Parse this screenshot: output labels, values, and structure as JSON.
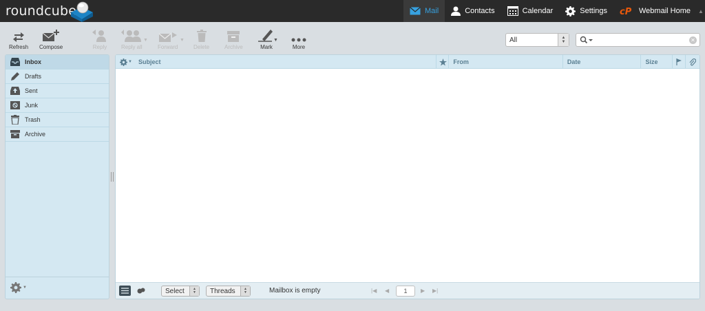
{
  "app": {
    "logo_text": "roundcube"
  },
  "topnav": {
    "mail": "Mail",
    "contacts": "Contacts",
    "calendar": "Calendar",
    "settings": "Settings",
    "webmail_home": "Webmail Home"
  },
  "toolbar": {
    "refresh": "Refresh",
    "compose": "Compose",
    "reply": "Reply",
    "reply_all": "Reply all",
    "forward": "Forward",
    "delete": "Delete",
    "archive": "Archive",
    "mark": "Mark",
    "more": "More"
  },
  "filter": {
    "value": "All"
  },
  "search": {
    "value": ""
  },
  "folders": [
    {
      "label": "Inbox",
      "icon": "inbox-icon"
    },
    {
      "label": "Drafts",
      "icon": "pencil-icon"
    },
    {
      "label": "Sent",
      "icon": "sent-icon"
    },
    {
      "label": "Junk",
      "icon": "junk-icon"
    },
    {
      "label": "Trash",
      "icon": "trash-icon"
    },
    {
      "label": "Archive",
      "icon": "archive-icon"
    }
  ],
  "columns": {
    "subject": "Subject",
    "from": "From",
    "date": "Date",
    "size": "Size"
  },
  "footer": {
    "select": "Select",
    "threads": "Threads",
    "status": "Mailbox is empty",
    "page": "1"
  },
  "colors": {
    "topbar": "#2a2a2a",
    "accent": "#37a1e0",
    "brand_orange": "#e8590c",
    "panel": "#d4e8f2"
  }
}
